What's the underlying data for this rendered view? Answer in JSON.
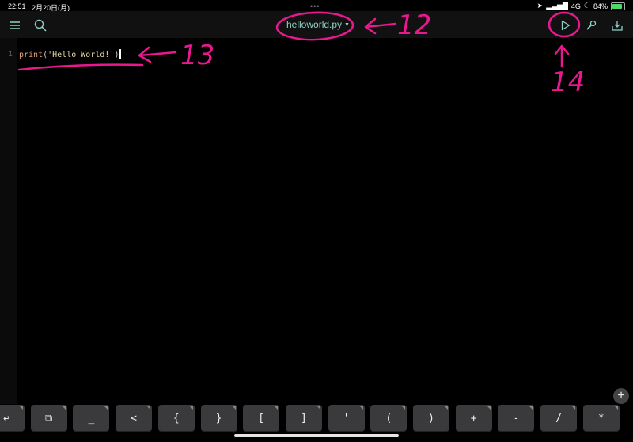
{
  "status_bar": {
    "time": "22:51",
    "date": "2月20日(月)",
    "network": "4G",
    "battery": "84%",
    "battery_level": 0.84
  },
  "toolbar": {
    "file_name": "helloworld.py",
    "menu_icon": "hamburger-menu-icon",
    "search_icon": "search-icon",
    "run_icon": "play-icon",
    "tools_icon": "wrench-icon",
    "share_icon": "share-icon"
  },
  "editor": {
    "lines": [
      {
        "number": "1",
        "fn": "print",
        "open": "(",
        "str": "'Hello World!'",
        "close": ")"
      }
    ]
  },
  "annotations": [
    {
      "label": "12"
    },
    {
      "label": "13"
    },
    {
      "label": "14"
    }
  ],
  "keyboard": {
    "keys": [
      "↩",
      "⧉",
      "_",
      "<",
      "{",
      "}",
      "[",
      "]",
      "'",
      "(",
      ")",
      "+",
      "-",
      "/",
      "*"
    ],
    "plus_label": "+"
  },
  "colors": {
    "accent": "#8fd1c3",
    "annotation": "#e9188f",
    "background": "#000000",
    "key": "#3a3a3c"
  }
}
